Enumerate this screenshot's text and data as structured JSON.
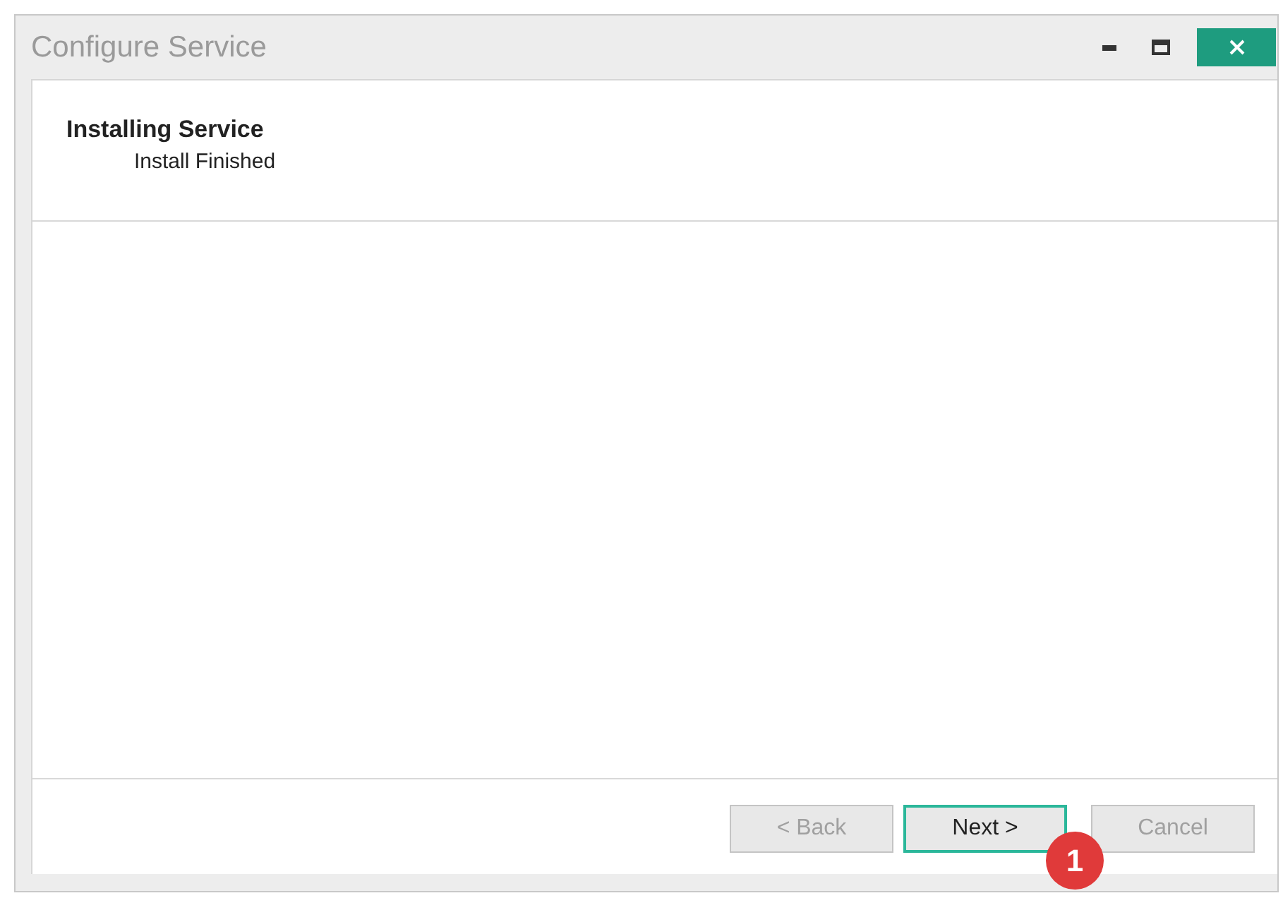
{
  "window": {
    "title": "Configure Service"
  },
  "header": {
    "title": "Installing Service",
    "subtitle": "Install Finished"
  },
  "buttons": [
    {
      "label": "< Back",
      "disabled": true,
      "focused": false
    },
    {
      "label": "Next >",
      "disabled": false,
      "focused": true
    },
    {
      "label": "Cancel",
      "disabled": true,
      "focused": false
    }
  ],
  "callout": {
    "label": "1"
  }
}
